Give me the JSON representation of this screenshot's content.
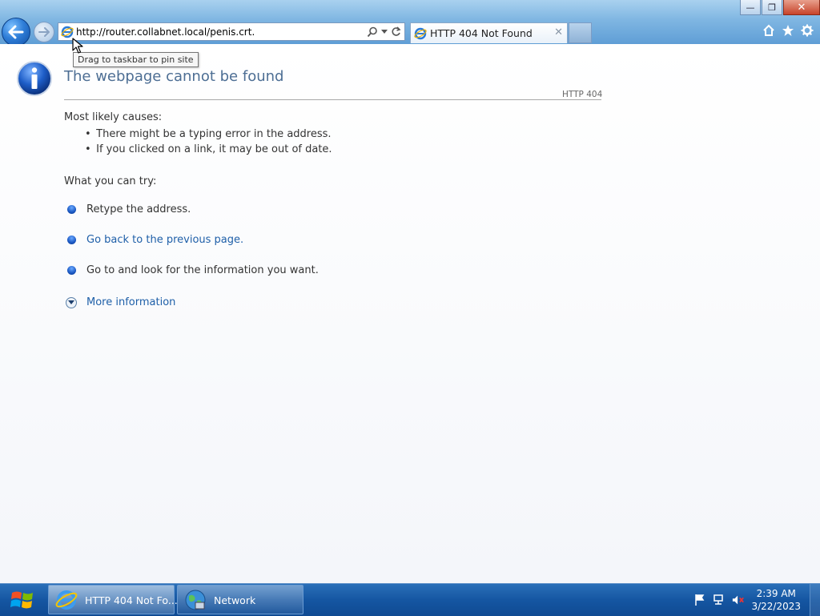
{
  "window": {
    "minimize_label": "—",
    "restore_label": "❐",
    "close_label": "✕"
  },
  "navigation": {
    "back_icon": "back-arrow-icon",
    "forward_icon": "forward-arrow-icon"
  },
  "address_bar": {
    "url": "http://router.collabnet.local/penis.crt."
  },
  "tab": {
    "title": "HTTP 404 Not Found",
    "close_label": "✕"
  },
  "tooltip": {
    "text": "Drag to taskbar to pin site"
  },
  "page": {
    "title": "The webpage cannot be found",
    "http_code": "HTTP 404",
    "causes_heading": "Most likely causes:",
    "causes": [
      "There might be a typing error in the address.",
      "If you clicked on a link, it may be out of date."
    ],
    "try_heading": "What you can try:",
    "try_items": [
      "Retype the address.",
      "Go back to the previous page.",
      "Go to  and look for the information you want."
    ],
    "more_info": "More information"
  },
  "taskbar": {
    "items": [
      {
        "label": "HTTP 404 Not Fo...",
        "icon": "internet-explorer-icon"
      },
      {
        "label": "Network",
        "icon": "network-globe-icon"
      }
    ],
    "clock_time": "2:39 AM",
    "clock_date": "3/22/2023"
  },
  "colors": {
    "title_blue": "#4d6e94",
    "link_blue": "#1e5fa8",
    "taskbar_blue": "#1556a2"
  }
}
